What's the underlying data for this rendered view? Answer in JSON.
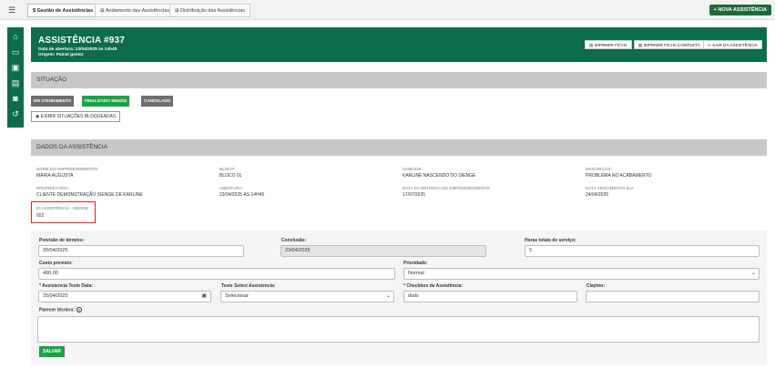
{
  "topbar": {
    "menu_icon": "☰",
    "tabs": [
      {
        "label": "Gestão de Assistências",
        "icon": "$"
      },
      {
        "label": "Andamento das Assistências",
        "icon": "⊞"
      },
      {
        "label": "Distribuição das Assistências",
        "icon": "⊞"
      }
    ],
    "new_button": "+ NOVA ASSISTÊNCIA"
  },
  "sidebar": {
    "icons": [
      "home-icon",
      "folder-icon",
      "calendar-icon",
      "document-icon",
      "chat-icon",
      "history-icon"
    ]
  },
  "header": {
    "title": "ASSISTÊNCIA #937",
    "opened": "Data de abertura: 23/04/2025 às 14h45",
    "origin": "Origem: Painel gestor",
    "buttons": {
      "print": "IMPRIMIR FICHA",
      "print_full": "IMPRIMIR FICHA COMPLETA",
      "exit": "SAIR DA ASSISTÊNCIA"
    }
  },
  "situacao": {
    "title": "SITUAÇÃO",
    "statuses": [
      "EM ATENDIMENTO",
      "FINALIZADO SIENGE",
      "CANCELADO"
    ],
    "show_blocked": "EXIBIR SITUAÇÕES BLOQUEADAS"
  },
  "dados": {
    "title": "DADOS DA ASSISTÊNCIA",
    "fields": {
      "empreendimento_label": "NOME DO EMPREENDIMENTO:",
      "empreendimento": "MARIA AUGUSTA",
      "bloco_label": "BLOCO:",
      "bloco": "BLOCO 01",
      "unidade_label": "UNIDADE:",
      "unidade": "KARLINE NASCENDO DO SIENGE",
      "descricao_label": "DESCRIÇÃO:",
      "descricao": "PROBLEMA NO ACABAMENTO",
      "proprietario_label": "PROPRIETÁRIO:",
      "proprietario": "CLIENTE DEMONSTRAÇÃO SIENGE DE KARLINE",
      "abertura_label": "ABERTURA:",
      "abertura": "23/04/2025 ÀS 14H45",
      "entrega_label": "DATA DA ENTREGA DO EMPREENDIMENTO:",
      "entrega": "17/07/2025",
      "sla_label": "DATA VENCIMENTO SLA",
      "sla": "24/04/2025",
      "id_label": "ID ASSISTÊNCIA - SIENGE",
      "id": "652"
    }
  },
  "form": {
    "previsao_label": "Previsão de término:",
    "previsao": "30/04/2025",
    "conclusao_label": "Conclusão:",
    "conclusao": "23/04/2025",
    "horas_label": "Horas totais de serviço:",
    "horas": "5",
    "custo_label": "Custo previsto:",
    "custo": "400,00",
    "prioridade_label": "Prioridade:",
    "prioridade": "Normal",
    "teste_data_label": "* Assistencia Teste Data:",
    "teste_data": "25/04/2025",
    "select_label": "Teste Select Assistencia:",
    "select": "Selecionar",
    "checkbox_label": "* Checkbox de Assistência:",
    "checkbox": "dsds",
    "clayton_label": "Clayton:",
    "clayton": "",
    "parecer_label": "Parecer técnico:",
    "save": "SALVAR"
  },
  "colors": {
    "brand": "#0d6b4e",
    "success": "#1aa34a",
    "highlight": "#e02020"
  }
}
